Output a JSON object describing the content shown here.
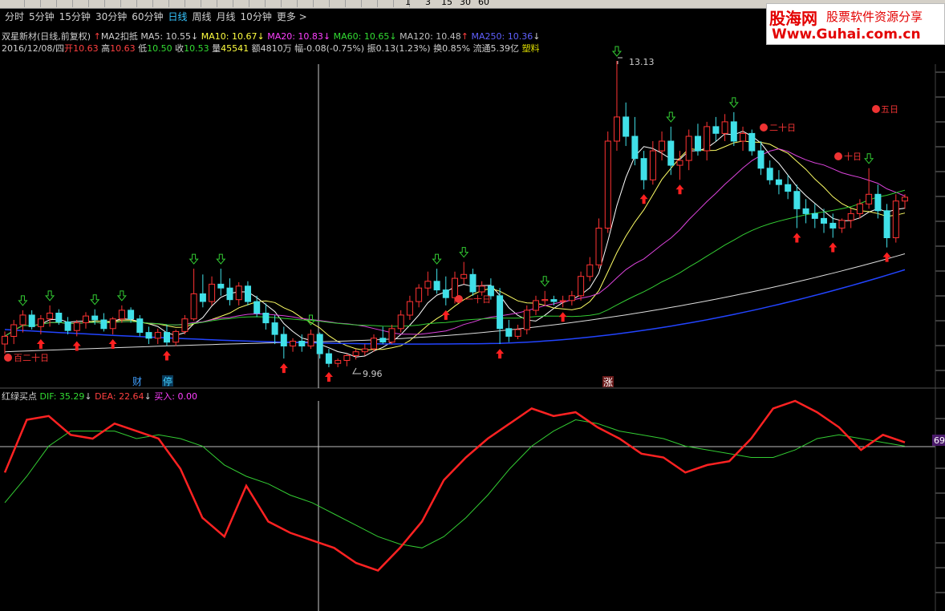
{
  "period_tabs": [
    "分时",
    "5分钟",
    "15分钟",
    "30分钟",
    "60分钟",
    "日线",
    "周线",
    "月线",
    "10分钟",
    "更多 >"
  ],
  "active_tab": "日线",
  "toolbar_numbers": [
    "1",
    "3",
    "15",
    "30",
    "60"
  ],
  "logo": {
    "brand": "股海网",
    "slogan": "股票软件资源分享",
    "url": "Www.Guhai.com.cn"
  },
  "ma_legend": {
    "title": "双星新材(日线,前复权)",
    "ma2": "MA2扣抵",
    "ma5": "MA5: 10.55",
    "ma10": "MA10: 10.67",
    "ma20": "MA20: 10.83",
    "ma60": "MA60: 10.65",
    "ma120": "MA120: 10.48",
    "ma250": "MA250: 10.36"
  },
  "quote": {
    "date": "2016/12/08/四",
    "open_label": "开",
    "open": "10.63",
    "high_label": "高",
    "high": "10.63",
    "low_label": "低",
    "low": "10.50",
    "close_label": "收",
    "close": "10.53",
    "volume_label": "量",
    "volume": "45541",
    "amount": "额4810万",
    "change": "幅-0.08(-0.75%)",
    "amplitude": "振0.13(1.23%)",
    "turnover": "换0.85%",
    "float_cap": "流通5.39亿",
    "sector": "塑料"
  },
  "indicator_legend": {
    "name": "红绿买点",
    "dif": "DIF: 35.29",
    "dea": "DEA: 22.64",
    "buy": "买入: 0.00"
  },
  "price_scale_label": "69",
  "markers": {
    "cai": "财",
    "ting": "停",
    "zhang": "涨"
  },
  "annotations": [
    "百二十日",
    "一十日",
    "二十日",
    "十日",
    "五日"
  ],
  "colors": {
    "up": "#ff3333",
    "down": "#40e0e8",
    "dif": "#ff2222",
    "dea": "#33cc33",
    "ma5": "#ffffff",
    "ma10": "#ffff66",
    "ma20": "#dd44dd",
    "ma60": "#33cc33",
    "ma120": "#dddddd",
    "ma250": "#2244ff"
  },
  "chart_data": {
    "type": "candlestick",
    "max_label": "13.13",
    "min_label": "9.96",
    "candles": [
      [
        10.2,
        10.33,
        10.1,
        10.28
      ],
      [
        10.28,
        10.45,
        10.2,
        10.4
      ],
      [
        10.4,
        10.55,
        10.32,
        10.5
      ],
      [
        10.5,
        10.55,
        10.35,
        10.38
      ],
      [
        10.38,
        10.5,
        10.3,
        10.46
      ],
      [
        10.46,
        10.6,
        10.38,
        10.52
      ],
      [
        10.52,
        10.56,
        10.4,
        10.43
      ],
      [
        10.43,
        10.48,
        10.3,
        10.34
      ],
      [
        10.34,
        10.45,
        10.28,
        10.42
      ],
      [
        10.42,
        10.53,
        10.36,
        10.49
      ],
      [
        10.49,
        10.56,
        10.4,
        10.45
      ],
      [
        10.45,
        10.52,
        10.33,
        10.36
      ],
      [
        10.36,
        10.48,
        10.3,
        10.46
      ],
      [
        10.46,
        10.6,
        10.42,
        10.55
      ],
      [
        10.55,
        10.58,
        10.42,
        10.46
      ],
      [
        10.46,
        10.5,
        10.28,
        10.32
      ],
      [
        10.32,
        10.38,
        10.2,
        10.26
      ],
      [
        10.26,
        10.36,
        10.2,
        10.32
      ],
      [
        10.32,
        10.4,
        10.18,
        10.22
      ],
      [
        10.22,
        10.35,
        10.18,
        10.33
      ],
      [
        10.33,
        10.5,
        10.3,
        10.46
      ],
      [
        10.46,
        10.98,
        10.44,
        10.72
      ],
      [
        10.72,
        10.92,
        10.58,
        10.64
      ],
      [
        10.64,
        10.9,
        10.6,
        10.82
      ],
      [
        10.82,
        10.98,
        10.7,
        10.78
      ],
      [
        10.78,
        10.88,
        10.6,
        10.66
      ],
      [
        10.66,
        10.84,
        10.6,
        10.8
      ],
      [
        10.8,
        10.85,
        10.6,
        10.64
      ],
      [
        10.64,
        10.7,
        10.48,
        10.52
      ],
      [
        10.52,
        10.62,
        10.35,
        10.42
      ],
      [
        10.42,
        10.5,
        10.2,
        10.3
      ],
      [
        10.3,
        10.38,
        10.05,
        10.18
      ],
      [
        10.18,
        10.26,
        10.12,
        10.23
      ],
      [
        10.23,
        10.3,
        10.12,
        10.18
      ],
      [
        10.18,
        10.35,
        10.15,
        10.3
      ],
      [
        10.3,
        10.32,
        10.05,
        10.1
      ],
      [
        10.1,
        10.15,
        9.96,
        10.0
      ],
      [
        10.0,
        10.05,
        9.96,
        10.03
      ],
      [
        10.03,
        10.1,
        9.97,
        10.08
      ],
      [
        10.08,
        10.15,
        10.04,
        10.12
      ],
      [
        10.12,
        10.2,
        10.08,
        10.15
      ],
      [
        10.15,
        10.3,
        10.12,
        10.26
      ],
      [
        10.26,
        10.38,
        10.2,
        10.22
      ],
      [
        10.22,
        10.4,
        10.2,
        10.36
      ],
      [
        10.36,
        10.55,
        10.32,
        10.5
      ],
      [
        10.5,
        10.7,
        10.45,
        10.64
      ],
      [
        10.64,
        10.82,
        10.58,
        10.78
      ],
      [
        10.78,
        10.95,
        10.7,
        10.85
      ],
      [
        10.85,
        10.98,
        10.72,
        10.76
      ],
      [
        10.76,
        10.9,
        10.6,
        10.68
      ],
      [
        10.68,
        10.95,
        10.62,
        10.88
      ],
      [
        10.88,
        11.05,
        10.82,
        10.92
      ],
      [
        10.92,
        10.98,
        10.7,
        10.74
      ],
      [
        10.74,
        10.85,
        10.7,
        10.8
      ],
      [
        10.8,
        10.88,
        10.66,
        10.7
      ],
      [
        10.7,
        10.78,
        10.2,
        10.36
      ],
      [
        10.36,
        10.45,
        10.22,
        10.28
      ],
      [
        10.28,
        10.4,
        10.25,
        10.35
      ],
      [
        10.35,
        10.6,
        10.3,
        10.55
      ],
      [
        10.55,
        10.7,
        10.5,
        10.65
      ],
      [
        10.65,
        10.75,
        10.6,
        10.66
      ],
      [
        10.66,
        10.7,
        10.6,
        10.64
      ],
      [
        10.64,
        10.7,
        10.58,
        10.65
      ],
      [
        10.65,
        10.75,
        10.6,
        10.7
      ],
      [
        10.7,
        10.95,
        10.65,
        10.9
      ],
      [
        10.9,
        11.1,
        10.85,
        11.02
      ],
      [
        11.02,
        11.5,
        10.98,
        11.4
      ],
      [
        11.4,
        12.4,
        11.35,
        12.3
      ],
      [
        12.3,
        13.13,
        12.2,
        12.55
      ],
      [
        12.55,
        12.7,
        12.25,
        12.35
      ],
      [
        12.35,
        12.55,
        12.05,
        12.12
      ],
      [
        12.12,
        12.2,
        11.8,
        11.9
      ],
      [
        11.9,
        12.3,
        11.85,
        12.2
      ],
      [
        12.2,
        12.4,
        12.1,
        12.3
      ],
      [
        12.3,
        12.45,
        11.95,
        12.05
      ],
      [
        12.05,
        12.2,
        11.9,
        12.1
      ],
      [
        12.1,
        12.42,
        12.0,
        12.35
      ],
      [
        12.35,
        12.48,
        12.15,
        12.2
      ],
      [
        12.2,
        12.5,
        12.1,
        12.45
      ],
      [
        12.45,
        12.55,
        12.3,
        12.38
      ],
      [
        12.38,
        12.58,
        12.3,
        12.5
      ],
      [
        12.5,
        12.6,
        12.25,
        12.3
      ],
      [
        12.3,
        12.45,
        12.2,
        12.38
      ],
      [
        12.38,
        12.42,
        12.15,
        12.2
      ],
      [
        12.2,
        12.3,
        11.95,
        12.02
      ],
      [
        12.02,
        12.1,
        11.85,
        11.9
      ],
      [
        11.9,
        12.0,
        11.75,
        11.85
      ],
      [
        11.85,
        11.95,
        11.7,
        11.78
      ],
      [
        11.78,
        11.85,
        11.4,
        11.6
      ],
      [
        11.6,
        11.7,
        11.45,
        11.55
      ],
      [
        11.55,
        11.65,
        11.4,
        11.5
      ],
      [
        11.5,
        11.6,
        11.35,
        11.45
      ],
      [
        11.45,
        11.55,
        11.3,
        11.4
      ],
      [
        11.4,
        11.5,
        11.35,
        11.48
      ],
      [
        11.48,
        11.6,
        11.4,
        11.55
      ],
      [
        11.55,
        11.7,
        11.5,
        11.65
      ],
      [
        11.65,
        12.02,
        11.6,
        11.75
      ],
      [
        11.75,
        11.85,
        11.5,
        11.58
      ],
      [
        11.58,
        11.65,
        11.2,
        11.3
      ],
      [
        11.3,
        11.75,
        11.25,
        11.68
      ],
      [
        11.68,
        11.75,
        11.6,
        11.72
      ]
    ],
    "indicator": {
      "dif": [
        62,
        90,
        92,
        82,
        80,
        88,
        84,
        80,
        64,
        38,
        28,
        55,
        36,
        30,
        26,
        22,
        14,
        10,
        22,
        36,
        58,
        70,
        80,
        88,
        96,
        92,
        94,
        86,
        80,
        72,
        70,
        62,
        66,
        68,
        80,
        96,
        100,
        94,
        86,
        74,
        82,
        78
      ],
      "dea": [
        46,
        60,
        76,
        84,
        84,
        84,
        80,
        82,
        80,
        76,
        66,
        60,
        56,
        50,
        46,
        40,
        34,
        28,
        24,
        22,
        28,
        38,
        50,
        64,
        76,
        84,
        90,
        88,
        84,
        82,
        80,
        76,
        74,
        72,
        70,
        70,
        74,
        80,
        82,
        80,
        78,
        76
      ]
    }
  }
}
